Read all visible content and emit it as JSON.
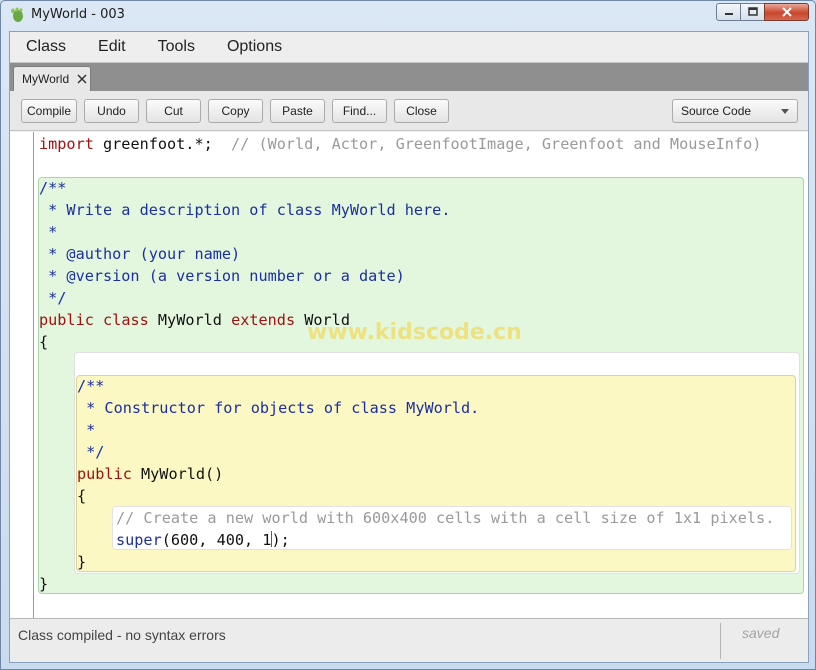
{
  "window": {
    "title": "MyWorld - 003"
  },
  "menu": [
    "Class",
    "Edit",
    "Tools",
    "Options"
  ],
  "tab": {
    "label": "MyWorld"
  },
  "toolbar": {
    "buttons": [
      "Compile",
      "Undo",
      "Cut",
      "Copy",
      "Paste",
      "Find...",
      "Close"
    ],
    "view_select": "Source Code"
  },
  "code": {
    "import_kw": "import",
    "import_rest": " greenfoot.*;  ",
    "import_comment": "// (World, Actor, GreenfootImage, Greenfoot and MouseInfo)",
    "doc1": "/**",
    "doc2": " * Write a description of class MyWorld here.",
    "doc3": " *",
    "doc4": " * @author (your name)",
    "doc5": " * @version (a version number or a date)",
    "doc6": " */",
    "kw_public": "public",
    "kw_class": "class",
    "class_name": "MyWorld",
    "kw_extends": "extends",
    "base_class": "World",
    "brace_open": "{",
    "cdoc1": "/**",
    "cdoc2": " * Constructor for objects of class MyWorld.",
    "cdoc3": " *",
    "cdoc4": " */",
    "ctor_public": "public",
    "ctor_sig": " MyWorld()",
    "ctor_brace_open": "{",
    "body_comment": "// Create a new world with 600x400 cells with a cell size of 1x1 pixels.",
    "super_kw": "super",
    "super_args_a": "(600, 400, 1",
    "super_args_b": ");",
    "ctor_brace_close": "}",
    "brace_close": "}"
  },
  "watermark": "www.kidscode.cn",
  "status": {
    "message": "Class compiled - no syntax errors",
    "saved": "saved"
  }
}
